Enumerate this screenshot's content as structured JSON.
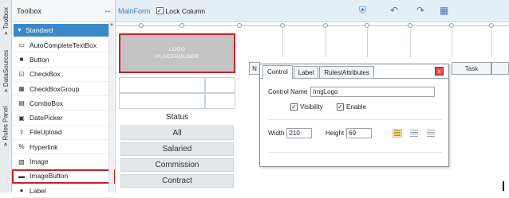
{
  "side_tabs": {
    "toolbox": "Toolbox",
    "datasources": "DataSources",
    "rules_panel": "Rules Panel"
  },
  "toolbox": {
    "title": "Toolbox",
    "section": "Standard",
    "items": [
      {
        "label": "AutoCompleteTextBox",
        "icon": "textbox-icon"
      },
      {
        "label": "Button",
        "icon": "button-icon"
      },
      {
        "label": "CheckBox",
        "icon": "checkbox-icon"
      },
      {
        "label": "CheckBoxGroup",
        "icon": "checkbox-group-icon"
      },
      {
        "label": "ComboBox",
        "icon": "combobox-icon"
      },
      {
        "label": "DatePicker",
        "icon": "calendar-icon"
      },
      {
        "label": "FileUpload",
        "icon": "upload-icon"
      },
      {
        "label": "Hyperlink",
        "icon": "link-icon"
      },
      {
        "label": "Image",
        "icon": "image-icon"
      },
      {
        "label": "ImageButton",
        "icon": "image-button-icon",
        "selected": true
      },
      {
        "label": "Label",
        "icon": "label-icon"
      }
    ]
  },
  "topbar": {
    "form_name": "MainForm",
    "lock_column": "Lock Column",
    "lock_checked": "✓"
  },
  "canvas": {
    "logo_line1": "LOGO",
    "logo_line2": "PLACEHOLDER",
    "status_header": "Status",
    "status_buttons": [
      "All",
      "Salaried",
      "Commission",
      "Contract"
    ],
    "column_headers": {
      "partial": "N",
      "task": "Task"
    }
  },
  "popup": {
    "tabs": [
      "Control",
      "Label",
      "Rules/Attributes"
    ],
    "active_tab": "Control",
    "control_name_label": "Control Name",
    "control_name_value": "ImgLogo",
    "visibility_label": "Visibility",
    "enable_label": "Enable",
    "width_label": "Width",
    "width_value": "210",
    "height_label": "Height",
    "height_value": "69",
    "close": "x"
  },
  "colors": {
    "accent": "#3a88c8",
    "selection": "#c8202a"
  }
}
